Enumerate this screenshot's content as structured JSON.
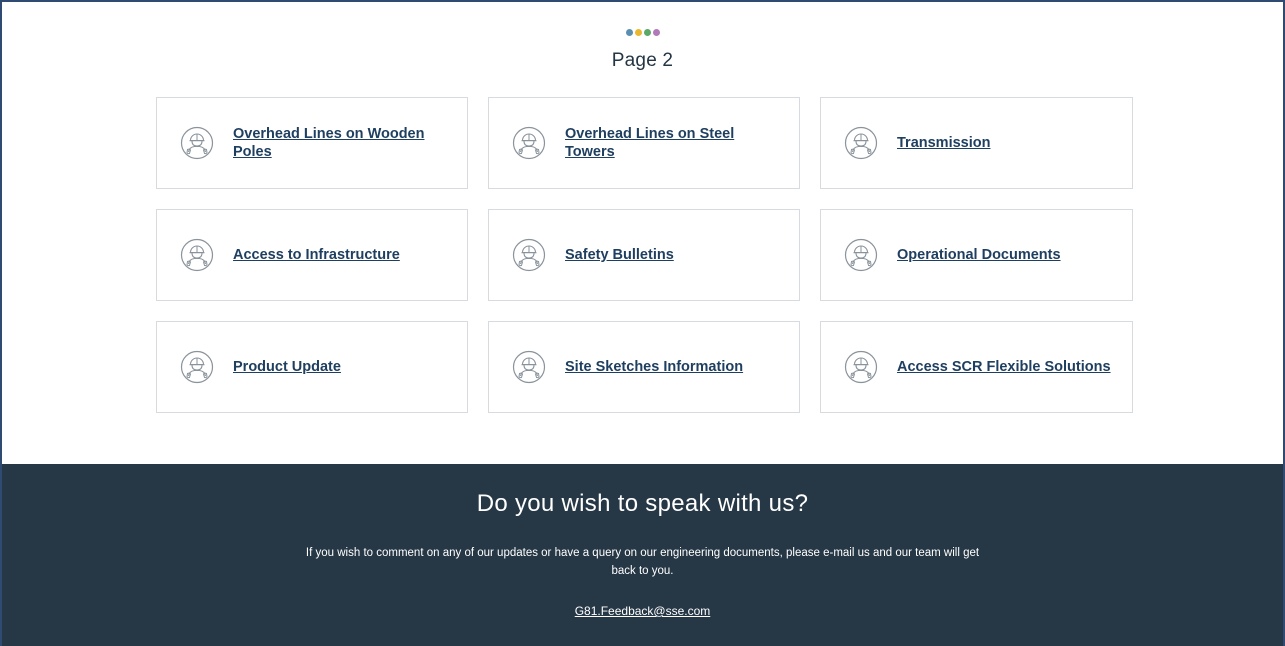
{
  "pagination": {
    "dots": [
      "#5a8fb0",
      "#e8b830",
      "#5ba869",
      "#b07ab8"
    ]
  },
  "page_title": "Page 2",
  "cards": [
    {
      "label": "Overhead Lines on Wooden Poles",
      "icon": "engineer-hardhat-icon"
    },
    {
      "label": "Overhead Lines on Steel Towers",
      "icon": "engineer-hardhat-icon"
    },
    {
      "label": "Transmission",
      "icon": "engineer-hardhat-icon"
    },
    {
      "label": "Access to Infrastructure",
      "icon": "engineer-hardhat-icon"
    },
    {
      "label": "Safety Bulletins",
      "icon": "engineer-hardhat-icon"
    },
    {
      "label": "Operational Documents",
      "icon": "engineer-hardhat-icon"
    },
    {
      "label": "Product Update",
      "icon": "engineer-hardhat-icon"
    },
    {
      "label": "Site Sketches Information",
      "icon": "engineer-hardhat-icon"
    },
    {
      "label": "Access SCR Flexible Solutions",
      "icon": "engineer-hardhat-icon"
    }
  ],
  "footer": {
    "title": "Do you wish to speak with us?",
    "text": "If you wish to comment on any of our updates or have a query on our engineering documents, please e-mail us and our team will get back to you.",
    "email": "G81.Feedback@sse.com"
  },
  "colors": {
    "link": "#1f3f60",
    "footer_bg": "#263746",
    "frame_border": "#2f4a73",
    "card_border": "#d7dbdf"
  }
}
